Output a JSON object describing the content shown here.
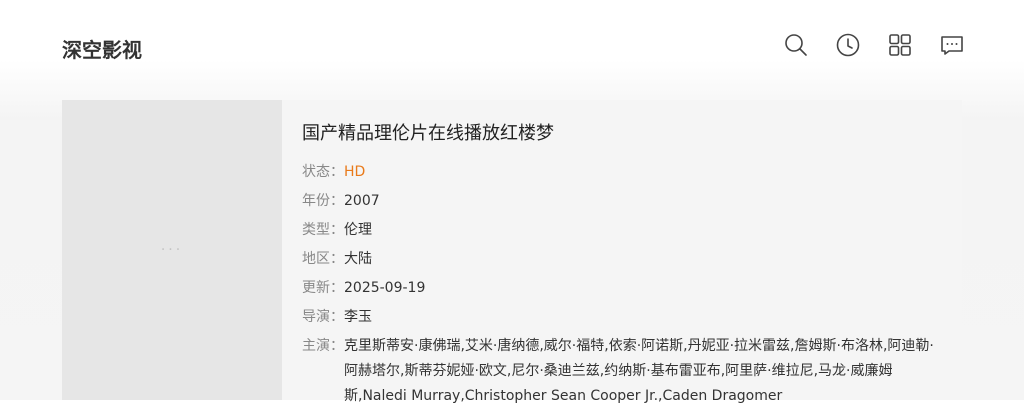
{
  "header": {
    "brand": "深空影视",
    "icons": [
      "search-icon",
      "history-icon",
      "grid-icon",
      "message-icon"
    ]
  },
  "detail": {
    "title": "国产精品理伦片在线播放红楼梦",
    "poster_placeholder": "···",
    "fields": [
      {
        "label": "状态：",
        "value": "HD"
      },
      {
        "label": "年份：",
        "value": "2007"
      },
      {
        "label": "类型：",
        "value": "伦理"
      },
      {
        "label": "地区：",
        "value": "大陆"
      },
      {
        "label": "更新：",
        "value": "2025-09-19"
      },
      {
        "label": "导演：",
        "value": "李玉"
      }
    ],
    "actors_label": "主演：",
    "actors": "克里斯蒂安·康佛瑞,艾米·唐纳德,威尔·福特,依索·阿诺斯,丹妮亚·拉米雷兹,詹姆斯·布洛林,阿迪勒·阿赫塔尔,斯蒂芬妮娅·欧文,尼尔·桑迪兰兹,约纳斯·基布雷亚布,阿里萨·维拉尼,马龙·威廉姆斯,Naledi Murray,Christopher Sean Cooper Jr.,Caden Dragomer"
  },
  "colors": {
    "status_accent": "#e97a1a"
  }
}
